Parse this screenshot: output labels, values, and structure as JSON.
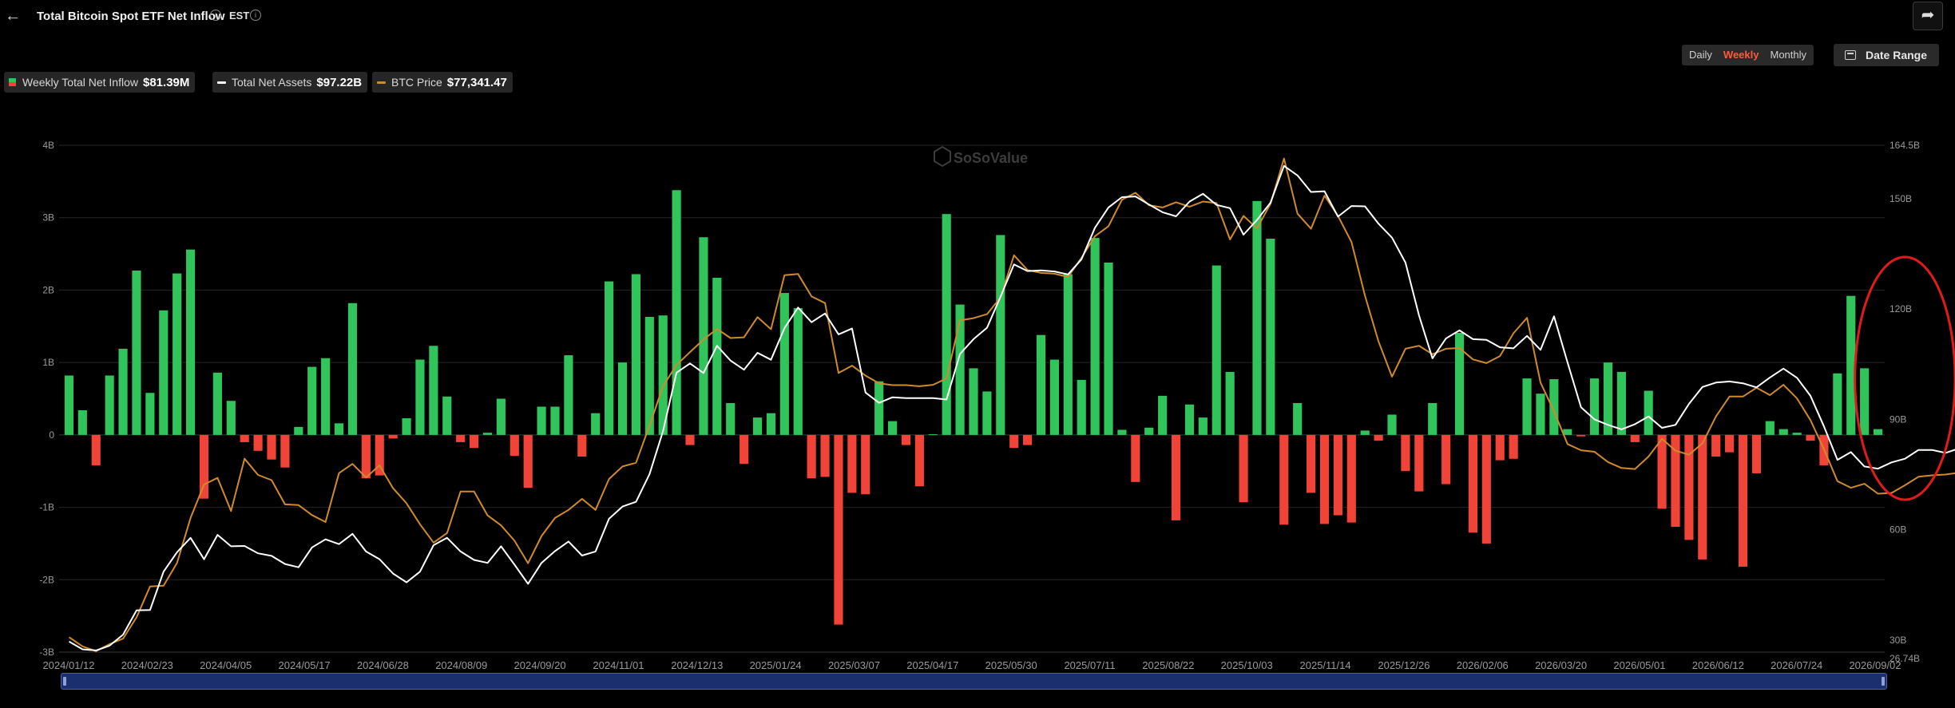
{
  "header": {
    "back_icon": "arrow-left-icon",
    "title": "Total Bitcoin Spot ETF Net Inflow",
    "timezone": "EST",
    "share_icon": "share-arrow-icon"
  },
  "controls": {
    "periods": [
      "Daily",
      "Weekly",
      "Monthly"
    ],
    "active_period": "Weekly",
    "date_range_label": "Date Range",
    "date_range_icon": "calendar-icon"
  },
  "legend": {
    "weekly_label": "Weekly Total Net Inflow",
    "weekly_value": "$81.39M",
    "assets_label": "Total Net Assets",
    "assets_value": "$97.22B",
    "btc_label": "BTC Price",
    "btc_value": "$77,341.47"
  },
  "watermark": "SoSoValue",
  "colors": {
    "inflow": "#30c45a",
    "outflow": "#f04438",
    "assets_line": "#ffffff",
    "btc_line": "#d08a2e",
    "highlight": "#e11b1b",
    "accent": "#ff5a3c"
  },
  "chart_data": {
    "type": "bar",
    "title": "Total Bitcoin Spot ETF Net Inflow",
    "grid": true,
    "y_left": {
      "ticks": [
        "4B",
        "3B",
        "2B",
        "1B",
        "0",
        "-1B",
        "-2B",
        "-3B"
      ],
      "range_billions": [
        -3,
        4
      ]
    },
    "y_right": {
      "ticks": [
        "164.5B",
        "150B",
        "120B",
        "90B",
        "60B",
        "30B",
        "26.74B"
      ],
      "range_billions": [
        26.74,
        164.5
      ]
    },
    "x_ticks": [
      "2024/01/12",
      "2024/02/23",
      "2024/04/05",
      "2024/05/17",
      "2024/06/28",
      "2024/08/09",
      "2024/09/20",
      "2024/11/01",
      "2024/12/13",
      "2025/01/24",
      "2025/03/07",
      "2025/04/17",
      "2025/05/30",
      "2025/07/11",
      "2025/08/22",
      "2025/10/03",
      "2025/11/14",
      "2025/12/26",
      "2026/02/06",
      "2026/03/20",
      "2026/05/01",
      "2026/06/12",
      "2026/07/24",
      "2026/09/02"
    ],
    "series": [
      {
        "name": "Weekly Total Net Inflow",
        "kind": "bar",
        "unit": "B USD",
        "values": [
          0.82,
          0.34,
          -0.42,
          0.82,
          1.19,
          2.27,
          0.58,
          1.72,
          2.23,
          2.56,
          -0.88,
          0.86,
          0.47,
          -0.1,
          -0.22,
          -0.34,
          -0.45,
          0.11,
          0.94,
          1.06,
          0.16,
          1.82,
          -0.6,
          -0.56,
          -0.05,
          0.23,
          1.04,
          1.23,
          0.53,
          -0.1,
          -0.18,
          0.03,
          0.5,
          -0.29,
          -0.73,
          0.39,
          0.39,
          1.1,
          -0.3,
          0.3,
          2.12,
          1.0,
          2.22,
          1.63,
          1.65,
          3.38,
          -0.14,
          2.73,
          2.17,
          0.44,
          -0.4,
          0.24,
          0.3,
          1.96,
          1.75,
          -0.6,
          -0.58,
          -2.62,
          -0.8,
          -0.82,
          0.74,
          0.19,
          -0.14,
          -0.71,
          0.01,
          3.05,
          1.8,
          0.92,
          0.6,
          2.76,
          -0.18,
          -0.14,
          1.38,
          1.04,
          2.22,
          0.76,
          2.72,
          2.38,
          0.07,
          -0.65,
          0.1,
          0.54,
          -1.18,
          0.42,
          0.24,
          2.34,
          0.87,
          -0.93,
          3.23,
          2.71,
          -1.24,
          0.44,
          -0.8,
          -1.23,
          -1.11,
          -1.21,
          0.06,
          -0.08,
          0.28,
          -0.5,
          -0.78,
          0.44,
          -0.68,
          1.41,
          -1.35,
          -1.5,
          -0.35,
          -0.33,
          0.78,
          0.57,
          0.77,
          0.08,
          -0.02,
          0.78,
          1.0,
          0.87,
          -0.1,
          0.61,
          -1.02,
          -1.27,
          -1.45,
          -1.72,
          -0.3,
          -0.24,
          -1.82,
          -0.53,
          0.19,
          0.08,
          0.03,
          -0.08,
          -0.42,
          0.85,
          1.92,
          0.92,
          0.08
        ]
      },
      {
        "name": "Total Net Assets",
        "kind": "line",
        "unit": "B USD",
        "values": [
          29.6,
          27.5,
          27.2,
          28.5,
          31.5,
          38.1,
          38.2,
          48.6,
          53.9,
          57.8,
          52.0,
          58.6,
          55.5,
          55.6,
          53.6,
          52.9,
          50.7,
          49.8,
          55.2,
          57.4,
          56.1,
          58.9,
          54.1,
          52.0,
          48.1,
          45.7,
          48.6,
          55.8,
          57.8,
          54.1,
          51.8,
          51.0,
          55.5,
          50.5,
          45.3,
          51.0,
          54.2,
          56.8,
          53.0,
          54.1,
          63.0,
          66.3,
          67.6,
          75.1,
          86.8,
          102.7,
          105.2,
          102.6,
          110.0,
          106.0,
          103.5,
          108.1,
          106.2,
          114.8,
          120.4,
          116.4,
          118.8,
          113.1,
          114.7,
          97.3,
          94.5,
          96.0,
          95.8,
          95.8,
          95.8,
          95.4,
          107.8,
          111.8,
          114.9,
          123.3,
          132.1,
          130.3,
          130.5,
          130.2,
          129.4,
          133.5,
          142.1,
          147.6,
          150.4,
          150.6,
          148.4,
          146.3,
          145.2,
          149.2,
          151.3,
          148.3,
          147.4,
          140.2,
          144.2,
          148.9,
          158.9,
          156.3,
          151.8,
          152.0,
          145.1,
          148.0,
          147.9,
          143.2,
          139.4,
          132.6,
          118.3,
          106.6,
          112.0,
          114.2,
          111.8,
          111.6,
          109.6,
          109.3,
          112.7,
          108.9,
          118.0,
          105.5,
          93.3,
          90.0,
          88.5,
          87.3,
          88.7,
          90.8,
          87.7,
          88.5,
          94.2,
          98.8,
          100.0,
          100.3,
          99.8,
          98.7,
          101.4,
          103.8,
          101.3,
          96.4,
          88.1,
          79.0,
          81.1,
          77.2,
          76.6,
          78.3,
          79.3,
          81.7,
          81.7,
          80.9,
          82.1,
          83.6,
          80.6,
          86.2,
          94.4,
          97.6,
          97.8,
          97.2
        ]
      },
      {
        "name": "BTC Price",
        "kind": "line",
        "unit": "B (right axis scale)",
        "values": [
          30.8,
          28.3,
          27.0,
          28.9,
          30.4,
          36.2,
          44.6,
          44.8,
          51.0,
          63.2,
          72.3,
          74.1,
          65.1,
          79.3,
          74.9,
          73.5,
          66.9,
          66.7,
          64.0,
          62.1,
          75.4,
          77.9,
          74.2,
          77.5,
          71.3,
          67.2,
          61.5,
          56.5,
          59.1,
          70.4,
          70.4,
          63.9,
          61.2,
          57.0,
          50.9,
          58.3,
          63.2,
          65.4,
          68.4,
          65.4,
          73.8,
          77.2,
          78.2,
          88.3,
          99.0,
          104.8,
          108.3,
          111.7,
          114.6,
          112.1,
          112.3,
          117.8,
          114.5,
          129.2,
          129.5,
          123.4,
          121.6,
          102.6,
          104.6,
          101.9,
          99.8,
          99.3,
          99.3,
          99.0,
          99.4,
          101.1,
          116.9,
          117.5,
          118.6,
          123.1,
          134.6,
          130.6,
          129.8,
          129.6,
          128.7,
          133.9,
          139.8,
          142.5,
          149.7,
          151.6,
          148.2,
          147.6,
          149.0,
          147.8,
          149.2,
          148.8,
          138.9,
          145.3,
          141.9,
          148.6,
          160.9,
          145.9,
          141.8,
          150.8,
          145.3,
          138.2,
          123.6,
          111.2,
          101.6,
          109.2,
          110.0,
          107.7,
          109.2,
          109.4,
          106.3,
          105.3,
          107.2,
          113.4,
          117.6,
          100.0,
          92.2,
          83.3,
          81.6,
          81.2,
          78.4,
          76.8,
          76.5,
          79.9,
          84.7,
          81.5,
          80.4,
          83.5,
          90.8,
          96.2,
          96.2,
          98.6,
          96.6,
          99.4,
          95.7,
          89.8,
          81.9,
          73.2,
          71.4,
          72.5,
          69.8,
          70.0,
          72.1,
          74.4,
          74.8,
          75.0,
          75.5,
          76.0,
          76.9,
          77.9,
          79.3,
          83.5,
          87.2,
          91.5,
          92.4
        ]
      }
    ],
    "annotations": [
      {
        "type": "ellipse",
        "label": "",
        "covers_series_range": [
          133,
          139
        ]
      }
    ]
  }
}
